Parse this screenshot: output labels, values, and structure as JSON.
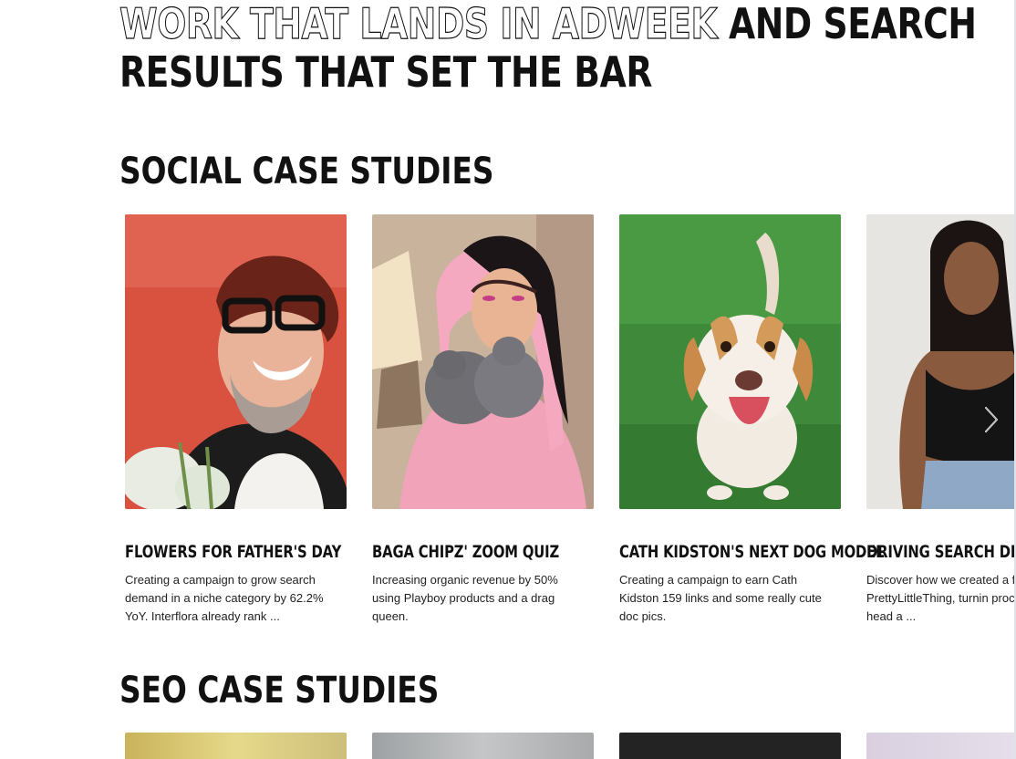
{
  "headline": {
    "outline_text": "WORK THAT LANDS IN ADWEEK",
    "solid_text_1": "AND SEARCH",
    "solid_text_2": "RESULTS THAT SET THE BAR"
  },
  "social_section": {
    "title": "SOCIAL CASE STUDIES",
    "cards": [
      {
        "title": "FLOWERS FOR FATHER'S DAY",
        "description": "Creating a campaign to grow search demand in a niche category by 62.2% YoY. Interflora already rank ..."
      },
      {
        "title": "BAGA CHIPZ' ZOOM QUIZ",
        "description": "Increasing organic revenue by 50% using Playboy products and a drag queen."
      },
      {
        "title": "CATH KIDSTON'S NEXT DOG MODEL",
        "description": "Creating a campaign to earn Cath Kidston 159 links and some really cute doc pics."
      },
      {
        "title": "DRIVING SEARCH DEMAND",
        "description": "Discover how we created a for PrettyLittleThing, turnin process on its head a ..."
      }
    ],
    "next_icon": "chevron-right-icon"
  },
  "seo_section": {
    "title": "SEO CASE STUDIES"
  },
  "colors": {
    "text": "#111111",
    "background": "#ffffff"
  }
}
